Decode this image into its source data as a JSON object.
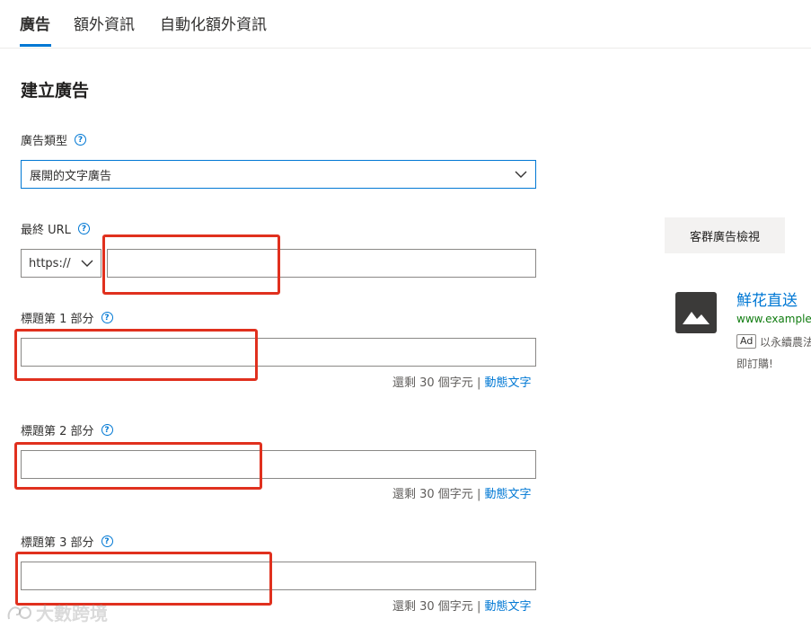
{
  "tabs": [
    {
      "label": "廣告"
    },
    {
      "label": "額外資訊"
    },
    {
      "label": "自動化額外資訊"
    }
  ],
  "section_title": "建立廣告",
  "ad_type": {
    "label": "廣告類型",
    "selected": "展開的文字廣告"
  },
  "final_url": {
    "label": "最終 URL",
    "protocol": "https://",
    "value": ""
  },
  "headline1": {
    "label": "標題第 1 部分",
    "value": "",
    "remaining": "還剩 30 個字元",
    "dynamic_text": "動態文字"
  },
  "headline2": {
    "label": "標題第 2 部分",
    "value": "",
    "remaining": "還剩 30 個字元",
    "dynamic_text": "動態文字"
  },
  "headline3": {
    "label": "標題第 3 部分",
    "value": "",
    "remaining": "還剩 30 個字元",
    "dynamic_text": "動態文字"
  },
  "counter_separator": "|",
  "help_icon": "?",
  "preview": {
    "button_label": "客群廣告檢視",
    "ad_title": "鮮花直送",
    "ad_url": "www.example.",
    "ad_badge": "Ad",
    "ad_desc_line1": "以永續農法",
    "ad_desc_line2": "即訂購!"
  },
  "watermark": "大數跨境",
  "colors": {
    "accent": "#0078d4",
    "highlight_box": "#e0301e",
    "url_green": "#107c10"
  },
  "icons": {
    "help": "question-circle-icon",
    "dropdown": "chevron-down-icon",
    "image": "image-placeholder-icon"
  }
}
